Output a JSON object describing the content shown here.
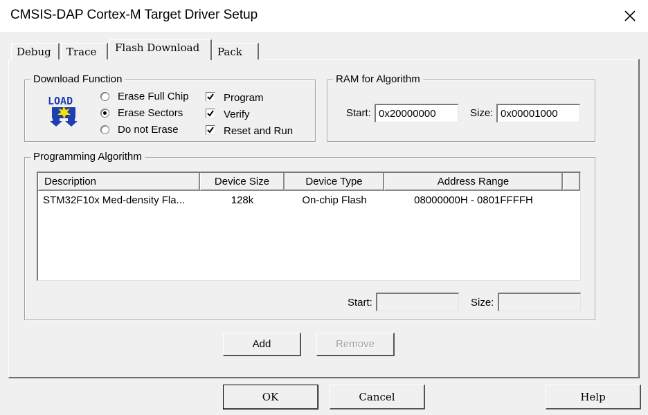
{
  "window": {
    "title": "CMSIS-DAP Cortex-M Target Driver Setup",
    "close_icon": "close-icon"
  },
  "tabs": [
    {
      "label": "Debug",
      "active": false
    },
    {
      "label": "Trace",
      "active": false
    },
    {
      "label": "Flash Download",
      "active": true
    },
    {
      "label": "Pack",
      "active": false
    }
  ],
  "download_function": {
    "legend": "Download Function",
    "icon": "load-icon",
    "icon_text": "LOAD",
    "radios": [
      {
        "label": "Erase Full Chip",
        "selected": false
      },
      {
        "label": "Erase Sectors",
        "selected": true
      },
      {
        "label": "Do not Erase",
        "selected": false
      }
    ],
    "checks": [
      {
        "label": "Program",
        "checked": true
      },
      {
        "label": "Verify",
        "checked": true
      },
      {
        "label": "Reset and Run",
        "checked": true
      }
    ]
  },
  "ram_for_algorithm": {
    "legend": "RAM for Algorithm",
    "start_label": "Start:",
    "start_value": "0x20000000",
    "size_label": "Size:",
    "size_value": "0x00001000"
  },
  "programming_algorithm": {
    "legend": "Programming Algorithm",
    "columns": [
      "Description",
      "Device Size",
      "Device Type",
      "Address Range"
    ],
    "rows": [
      {
        "description": "STM32F10x Med-density Fla...",
        "device_size": "128k",
        "device_type": "On-chip Flash",
        "address_range": "08000000H - 0801FFFFH"
      }
    ],
    "start_label": "Start:",
    "start_value": "",
    "size_label": "Size:",
    "size_value": ""
  },
  "buttons": {
    "add": "Add",
    "remove": "Remove",
    "ok": "OK",
    "cancel": "Cancel",
    "help": "Help"
  },
  "colors": {
    "background": "#f0f0f0",
    "titlebar": "#ffffff",
    "load_icon_blue": "#1f3fb0",
    "load_icon_yellow": "#f6e200",
    "disabled_text": "#a0a0a0"
  }
}
